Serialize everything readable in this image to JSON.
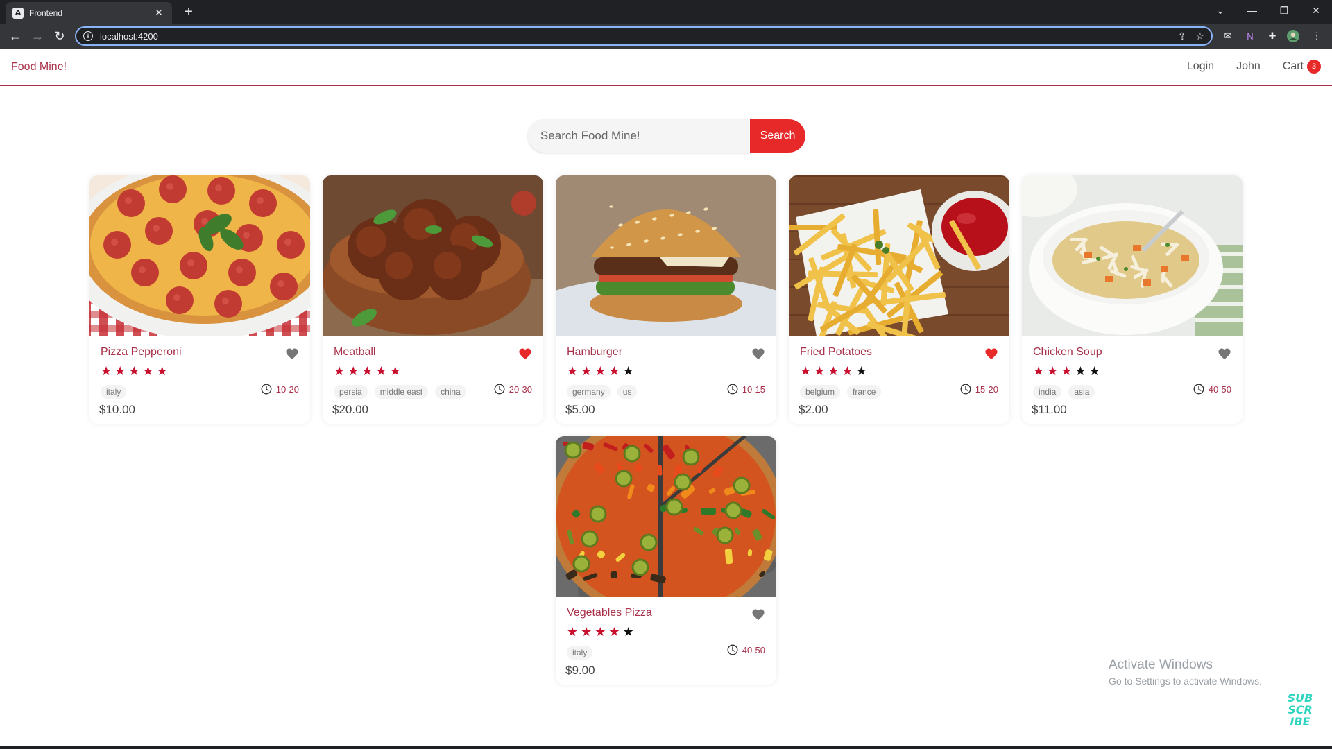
{
  "browser": {
    "tab_title": "Frontend",
    "favicon": "A",
    "url": "localhost:4200"
  },
  "app": {
    "logo": "Food Mine!",
    "nav": {
      "login": "Login",
      "user": "John",
      "cart": "Cart",
      "cart_count": "3"
    },
    "search": {
      "placeholder": "Search Food Mine!",
      "button": "Search"
    }
  },
  "foods": [
    {
      "name": "Pizza Pepperoni",
      "stars": 5,
      "favorite": false,
      "tags": [
        "italy"
      ],
      "cook_time": "10-20",
      "price": "$10.00",
      "image": "pizza-pepperoni"
    },
    {
      "name": "Meatball",
      "stars": 5,
      "favorite": true,
      "tags": [
        "persia",
        "middle east",
        "china"
      ],
      "cook_time": "20-30",
      "price": "$20.00",
      "image": "meatball"
    },
    {
      "name": "Hamburger",
      "stars": 4,
      "favorite": false,
      "tags": [
        "germany",
        "us"
      ],
      "cook_time": "10-15",
      "price": "$5.00",
      "image": "hamburger"
    },
    {
      "name": "Fried Potatoes",
      "stars": 4,
      "favorite": true,
      "tags": [
        "belgium",
        "france"
      ],
      "cook_time": "15-20",
      "price": "$2.00",
      "image": "fried-potatoes"
    },
    {
      "name": "Chicken Soup",
      "stars": 3,
      "favorite": false,
      "tags": [
        "india",
        "asia"
      ],
      "cook_time": "40-50",
      "price": "$11.00",
      "image": "chicken-soup"
    },
    {
      "name": "Vegetables Pizza",
      "stars": 4,
      "favorite": false,
      "tags": [
        "italy"
      ],
      "cook_time": "40-50",
      "price": "$9.00",
      "image": "vegetables-pizza"
    }
  ],
  "colors": {
    "brand": "#a8324a",
    "accent": "#e72929",
    "star_filled": "#c8102e",
    "star_empty": "#111111",
    "heart_active": "#e72929",
    "heart_inactive": "#777777"
  },
  "overlay": {
    "activate_title": "Activate Windows",
    "activate_sub": "Go to Settings to activate Windows.",
    "subscribe": "SUB SCR IBE"
  }
}
